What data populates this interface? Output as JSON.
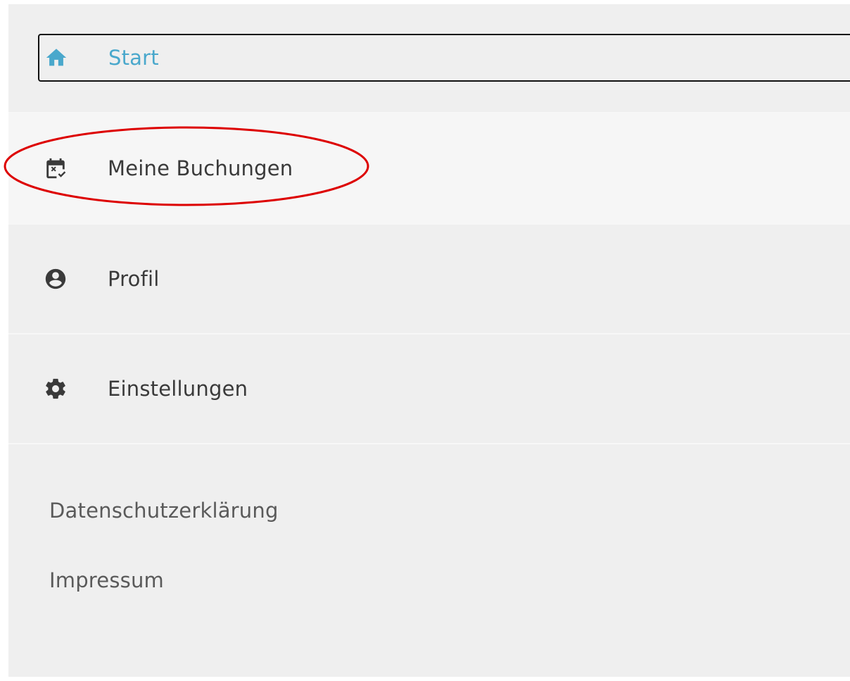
{
  "nav": {
    "items": [
      {
        "label": "Start",
        "icon": "home-icon",
        "active": true
      },
      {
        "label": "Meine Buchungen",
        "icon": "calendar-check-icon",
        "highlighted": true
      },
      {
        "label": "Profil",
        "icon": "account-circle-icon"
      },
      {
        "label": "Einstellungen",
        "icon": "gear-icon"
      }
    ]
  },
  "footer": {
    "links": [
      {
        "label": "Datenschutzerklärung"
      },
      {
        "label": "Impressum"
      }
    ]
  },
  "colors": {
    "panel_bg": "#efefef",
    "active_text": "#4aa8cc",
    "text": "#3a3a3a",
    "annotation": "#dd0000"
  }
}
